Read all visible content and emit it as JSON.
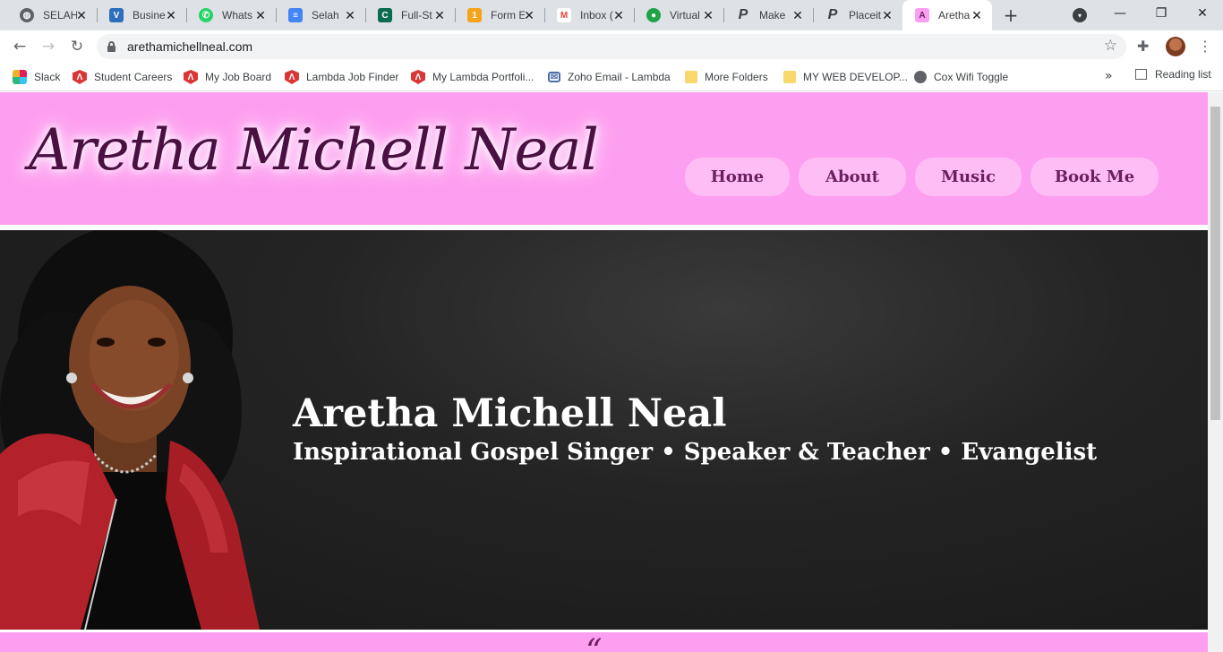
{
  "browser": {
    "tabs": [
      {
        "title": "SELAH",
        "icon": "globe-icon",
        "color": "#5f6368"
      },
      {
        "title": "Busine",
        "icon": "vistaprint-icon",
        "color": "#2c6fbb"
      },
      {
        "title": "Whats",
        "icon": "whatsapp-icon",
        "color": "#25d366"
      },
      {
        "title": "Selah",
        "icon": "google-docs-icon",
        "color": "#4285f4"
      },
      {
        "title": "Full-St",
        "icon": "c-logo-icon",
        "color": "#0b6b4f"
      },
      {
        "title": "Form E",
        "icon": "form-builder-icon",
        "color": "#f4a31b"
      },
      {
        "title": "Inbox (",
        "icon": "gmail-icon",
        "color": "#ea4335"
      },
      {
        "title": "Virtual",
        "icon": "mic-icon",
        "color": "#1ea446"
      },
      {
        "title": "Make",
        "icon": "p-logo-icon",
        "color": "#3c4043"
      },
      {
        "title": "Placeit",
        "icon": "p-logo-icon",
        "color": "#3c4043"
      },
      {
        "title": "Aretha",
        "icon": "site-favicon-icon",
        "color": "#fd9ff0",
        "active": true
      }
    ],
    "new_tab_symbol": "+",
    "address": {
      "url": "arethamichellneal.com"
    },
    "bookmarks": [
      {
        "label": "Slack",
        "icon": "slack-icon"
      },
      {
        "label": "Student Careers",
        "icon": "lambda-icon"
      },
      {
        "label": "My Job Board",
        "icon": "lambda-icon"
      },
      {
        "label": "Lambda Job Finder",
        "icon": "lambda-icon"
      },
      {
        "label": "My Lambda Portfoli...",
        "icon": "lambda-icon"
      },
      {
        "label": "Zoho Email - Lambda",
        "icon": "zoho-icon"
      },
      {
        "label": "More Folders",
        "icon": "folder-icon"
      },
      {
        "label": "MY WEB DEVELOP...",
        "icon": "folder-icon"
      },
      {
        "label": "Cox Wifi Toggle",
        "icon": "globe-icon"
      }
    ],
    "bookmarks_overflow": "»",
    "reading_list": "Reading list"
  },
  "site": {
    "logo": "Aretha Michell Neal",
    "nav": [
      "Home",
      "About",
      "Music",
      "Book Me"
    ],
    "hero": {
      "title": "Aretha Michell Neal",
      "subtitle": "Inspirational Gospel Singer • Speaker & Teacher • Evangelist"
    },
    "next_section_glyph": "“"
  },
  "colors": {
    "header_pink": "#fd9ff0",
    "nav_pill": "#ffbdf5",
    "nav_text": "#6b1f60",
    "logo_text": "#4a1042",
    "hero_bg": "#1c1c1c"
  }
}
